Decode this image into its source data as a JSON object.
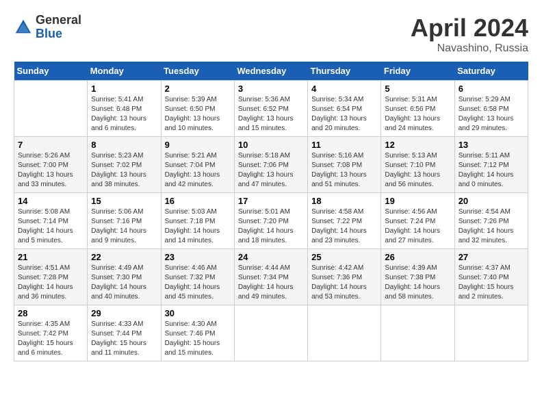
{
  "header": {
    "logo_general": "General",
    "logo_blue": "Blue",
    "title": "April 2024",
    "location": "Navashino, Russia"
  },
  "weekdays": [
    "Sunday",
    "Monday",
    "Tuesday",
    "Wednesday",
    "Thursday",
    "Friday",
    "Saturday"
  ],
  "weeks": [
    [
      {
        "day": "",
        "info": ""
      },
      {
        "day": "1",
        "info": "Sunrise: 5:41 AM\nSunset: 6:48 PM\nDaylight: 13 hours\nand 6 minutes."
      },
      {
        "day": "2",
        "info": "Sunrise: 5:39 AM\nSunset: 6:50 PM\nDaylight: 13 hours\nand 10 minutes."
      },
      {
        "day": "3",
        "info": "Sunrise: 5:36 AM\nSunset: 6:52 PM\nDaylight: 13 hours\nand 15 minutes."
      },
      {
        "day": "4",
        "info": "Sunrise: 5:34 AM\nSunset: 6:54 PM\nDaylight: 13 hours\nand 20 minutes."
      },
      {
        "day": "5",
        "info": "Sunrise: 5:31 AM\nSunset: 6:56 PM\nDaylight: 13 hours\nand 24 minutes."
      },
      {
        "day": "6",
        "info": "Sunrise: 5:29 AM\nSunset: 6:58 PM\nDaylight: 13 hours\nand 29 minutes."
      }
    ],
    [
      {
        "day": "7",
        "info": "Sunrise: 5:26 AM\nSunset: 7:00 PM\nDaylight: 13 hours\nand 33 minutes."
      },
      {
        "day": "8",
        "info": "Sunrise: 5:23 AM\nSunset: 7:02 PM\nDaylight: 13 hours\nand 38 minutes."
      },
      {
        "day": "9",
        "info": "Sunrise: 5:21 AM\nSunset: 7:04 PM\nDaylight: 13 hours\nand 42 minutes."
      },
      {
        "day": "10",
        "info": "Sunrise: 5:18 AM\nSunset: 7:06 PM\nDaylight: 13 hours\nand 47 minutes."
      },
      {
        "day": "11",
        "info": "Sunrise: 5:16 AM\nSunset: 7:08 PM\nDaylight: 13 hours\nand 51 minutes."
      },
      {
        "day": "12",
        "info": "Sunrise: 5:13 AM\nSunset: 7:10 PM\nDaylight: 13 hours\nand 56 minutes."
      },
      {
        "day": "13",
        "info": "Sunrise: 5:11 AM\nSunset: 7:12 PM\nDaylight: 14 hours\nand 0 minutes."
      }
    ],
    [
      {
        "day": "14",
        "info": "Sunrise: 5:08 AM\nSunset: 7:14 PM\nDaylight: 14 hours\nand 5 minutes."
      },
      {
        "day": "15",
        "info": "Sunrise: 5:06 AM\nSunset: 7:16 PM\nDaylight: 14 hours\nand 9 minutes."
      },
      {
        "day": "16",
        "info": "Sunrise: 5:03 AM\nSunset: 7:18 PM\nDaylight: 14 hours\nand 14 minutes."
      },
      {
        "day": "17",
        "info": "Sunrise: 5:01 AM\nSunset: 7:20 PM\nDaylight: 14 hours\nand 18 minutes."
      },
      {
        "day": "18",
        "info": "Sunrise: 4:58 AM\nSunset: 7:22 PM\nDaylight: 14 hours\nand 23 minutes."
      },
      {
        "day": "19",
        "info": "Sunrise: 4:56 AM\nSunset: 7:24 PM\nDaylight: 14 hours\nand 27 minutes."
      },
      {
        "day": "20",
        "info": "Sunrise: 4:54 AM\nSunset: 7:26 PM\nDaylight: 14 hours\nand 32 minutes."
      }
    ],
    [
      {
        "day": "21",
        "info": "Sunrise: 4:51 AM\nSunset: 7:28 PM\nDaylight: 14 hours\nand 36 minutes."
      },
      {
        "day": "22",
        "info": "Sunrise: 4:49 AM\nSunset: 7:30 PM\nDaylight: 14 hours\nand 40 minutes."
      },
      {
        "day": "23",
        "info": "Sunrise: 4:46 AM\nSunset: 7:32 PM\nDaylight: 14 hours\nand 45 minutes."
      },
      {
        "day": "24",
        "info": "Sunrise: 4:44 AM\nSunset: 7:34 PM\nDaylight: 14 hours\nand 49 minutes."
      },
      {
        "day": "25",
        "info": "Sunrise: 4:42 AM\nSunset: 7:36 PM\nDaylight: 14 hours\nand 53 minutes."
      },
      {
        "day": "26",
        "info": "Sunrise: 4:39 AM\nSunset: 7:38 PM\nDaylight: 14 hours\nand 58 minutes."
      },
      {
        "day": "27",
        "info": "Sunrise: 4:37 AM\nSunset: 7:40 PM\nDaylight: 15 hours\nand 2 minutes."
      }
    ],
    [
      {
        "day": "28",
        "info": "Sunrise: 4:35 AM\nSunset: 7:42 PM\nDaylight: 15 hours\nand 6 minutes."
      },
      {
        "day": "29",
        "info": "Sunrise: 4:33 AM\nSunset: 7:44 PM\nDaylight: 15 hours\nand 11 minutes."
      },
      {
        "day": "30",
        "info": "Sunrise: 4:30 AM\nSunset: 7:46 PM\nDaylight: 15 hours\nand 15 minutes."
      },
      {
        "day": "",
        "info": ""
      },
      {
        "day": "",
        "info": ""
      },
      {
        "day": "",
        "info": ""
      },
      {
        "day": "",
        "info": ""
      }
    ]
  ]
}
